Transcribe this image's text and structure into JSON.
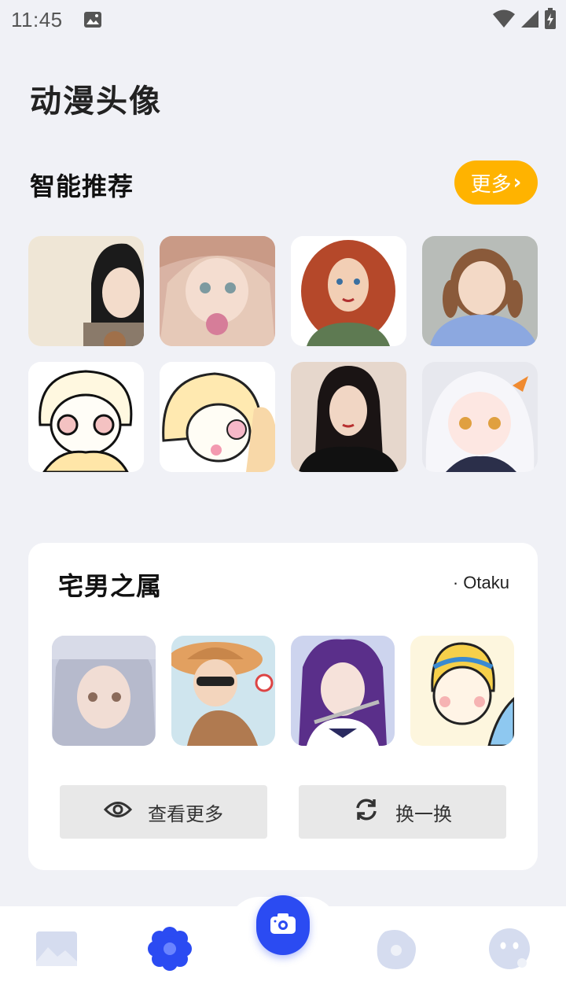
{
  "status": {
    "time": "11:45"
  },
  "header": {
    "title": "动漫头像"
  },
  "recommend": {
    "title": "智能推荐",
    "more_label": "更多",
    "avatars": [
      {
        "icon": "girl-portrait-black-hair"
      },
      {
        "icon": "anime-girl-lollipop"
      },
      {
        "icon": "curly-red-hair-girl"
      },
      {
        "icon": "girl-pigtails-blue-sweater"
      },
      {
        "icon": "chibi-blonde-child"
      },
      {
        "icon": "chibi-sleepy-girl"
      },
      {
        "icon": "woman-black-dress"
      },
      {
        "icon": "anime-white-hair-girl"
      }
    ]
  },
  "otaku": {
    "title": "宅男之属",
    "subtitle": "· Otaku",
    "avatars": [
      {
        "icon": "anime-girl-grey-hair"
      },
      {
        "icon": "anime-girl-straw-hat-sunglasses"
      },
      {
        "icon": "anime-girl-purple-hair-flute"
      },
      {
        "icon": "cartoon-boy-yellow-hair"
      }
    ],
    "view_more_label": "查看更多",
    "swap_label": "换一换"
  },
  "nav": {
    "items": [
      {
        "icon": "gallery-icon"
      },
      {
        "icon": "flower-icon",
        "active": true
      },
      {
        "icon": "camera-icon"
      },
      {
        "icon": "blob-icon"
      },
      {
        "icon": "face-icon"
      }
    ]
  },
  "colors": {
    "accent": "#2b4bf2",
    "more_button": "#ffb300",
    "inactive_icon": "#d5dcef"
  }
}
